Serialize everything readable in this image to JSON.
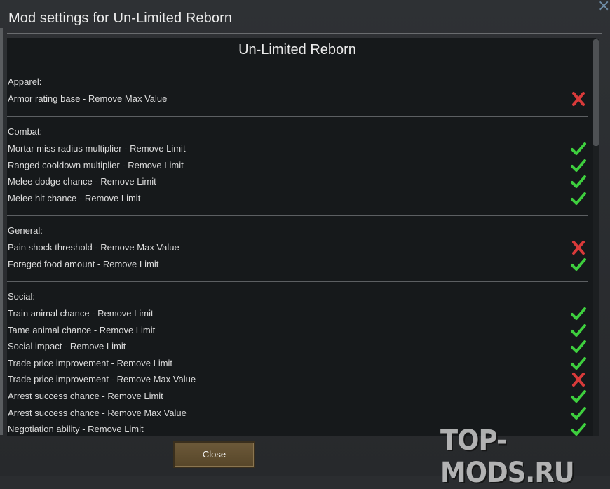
{
  "window": {
    "title": "Mod settings for Un-Limited Reborn",
    "close_icon": "×"
  },
  "panel": {
    "heading": "Un-Limited Reborn",
    "sections": [
      {
        "label": "Apparel:",
        "items": [
          {
            "label": "Armor rating base - Remove Max Value",
            "enabled": false
          }
        ]
      },
      {
        "label": "Combat:",
        "items": [
          {
            "label": "Mortar miss radius multiplier - Remove Limit",
            "enabled": true
          },
          {
            "label": "Ranged cooldown multiplier - Remove Limit",
            "enabled": true
          },
          {
            "label": "Melee dodge chance - Remove Limit",
            "enabled": true
          },
          {
            "label": "Melee hit chance - Remove Limit",
            "enabled": true
          }
        ]
      },
      {
        "label": "General:",
        "items": [
          {
            "label": "Pain shock threshold - Remove Max Value",
            "enabled": false
          },
          {
            "label": "Foraged food amount - Remove Limit",
            "enabled": true
          }
        ]
      },
      {
        "label": "Social:",
        "items": [
          {
            "label": "Train animal chance - Remove Limit",
            "enabled": true
          },
          {
            "label": "Tame animal chance - Remove Limit",
            "enabled": true
          },
          {
            "label": "Social impact - Remove Limit",
            "enabled": true
          },
          {
            "label": "Trade price improvement - Remove Limit",
            "enabled": true
          },
          {
            "label": "Trade price improvement - Remove Max Value",
            "enabled": false
          },
          {
            "label": "Arrest success chance - Remove Limit",
            "enabled": true
          },
          {
            "label": "Arrest success chance - Remove Max Value",
            "enabled": true
          },
          {
            "label": "Negotiation ability - Remove Limit",
            "enabled": true
          }
        ]
      }
    ]
  },
  "footer": {
    "close_label": "Close"
  },
  "watermark": "TOP-MODS.RU",
  "colors": {
    "check": "#3ecf3e",
    "cross": "#d93a3a",
    "panel_bg": "#16191b",
    "button_bg": "#6c5939"
  }
}
